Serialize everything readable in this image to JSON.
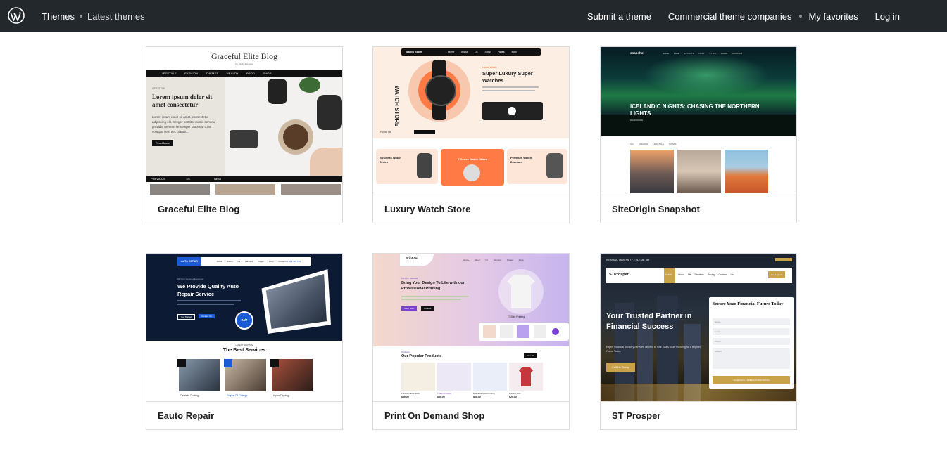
{
  "topbar": {
    "logo": "wordpress-logo",
    "breadcrumb": [
      "Themes",
      "Latest themes"
    ],
    "links": [
      "Submit a theme",
      "Commercial theme companies",
      "My favorites",
      "Log in"
    ]
  },
  "themes": [
    {
      "name": "Graceful Elite Blog",
      "preview": {
        "site_title": "Graceful Elite Blog",
        "tagline": "It's Totally Everyday",
        "menu": [
          "LIFESTYLE",
          "FASHION",
          "THEMES",
          "HEALTH",
          "FOOD",
          "SHOP"
        ],
        "kicker": "LIFESTYLE",
        "headline": "Lorem ipsum dolor sit amet consectetur",
        "body": "Lorem ipsum dolor sit amet, consectetur adipiscing elit. Integer porttitor mattis sem eu gravida. Aenean se semper placerat. Cras volutpat sem nec blandit...",
        "button": "Read More",
        "prev": "PREVIOUS",
        "page": "1/5",
        "next": "NEXT"
      }
    },
    {
      "name": "Luxury Watch Store",
      "preview": {
        "logo": "Watch Store",
        "menu": [
          "Home",
          "About Us",
          "Shop",
          "Pages",
          "Blog"
        ],
        "vertical": "WATCH STORE",
        "kicker": "Latest Watch",
        "headline": "Super Luxury Super Watches",
        "follow": "Follow Us",
        "sub1": "Business Watch Series",
        "promo": "Z Series Watch Offers",
        "sub2": "Premium Watch Discount"
      }
    },
    {
      "name": "SiteOrigin Snapshot",
      "preview": {
        "logo": "snapshot",
        "menu": [
          "HOME",
          "PAGE LAYOUTS",
          "POST",
          "STYLE GUIDE",
          "CONTACT"
        ],
        "headline": "ICELANDIC NIGHTS: CHASING THE NORTHERN LIGHTS",
        "read": "READ MORE",
        "filters": [
          "ALL",
          "FASHION",
          "LIFESTYLE",
          "TRAVEL"
        ]
      }
    },
    {
      "name": "Eauto Repair",
      "preview": {
        "logo": "AUTO REPAIR",
        "menu": [
          "Home",
          "About Us",
          "Services",
          "Pages",
          "Shop",
          "Contact"
        ],
        "phone": "+1 123 456 789",
        "kicker": "All Type Services Electronic",
        "headline": "We Provide Quality Auto Repair Service",
        "button1": "Get Started",
        "button2": "Contact Us",
        "badge": "24/7",
        "section_kicker": "LATEST SERVICE",
        "section_title": "The Best Services",
        "services": [
          "Ceramic Coating",
          "Engine Oil Change",
          "Hydro Dipping"
        ]
      }
    },
    {
      "name": "Print On Demand Shop",
      "preview": {
        "logo": "Print On",
        "menu": [
          "Home",
          "About Us",
          "Services",
          "Pages",
          "Shop"
        ],
        "kicker": "Print On Demand",
        "headline": "Bring Your Design To Life with our Professional Printing",
        "button1": "Shop Now",
        "button2": "Contact",
        "tshirt": "T-Shirt Printing",
        "section_kicker": "Products",
        "section_title": "Our Popular Products",
        "view_all": "View All",
        "products": [
          {
            "name": "Printed Name Here",
            "price": "$35.00"
          },
          {
            "name": "T-Shirt Printing",
            "price": "$35.00"
          },
          {
            "name": "Business Card Printing",
            "price": "$60.00"
          },
          {
            "name": "Printed Shirt",
            "price": "$20.00"
          }
        ]
      }
    },
    {
      "name": "ST Prosper",
      "preview": {
        "hours": "09:00 AM - 08:00 PM",
        "phone": "+ 1 012 456 789",
        "logo": "STProsper",
        "menu": [
          "Home",
          "About Us",
          "Services",
          "Pricing",
          "Contact Us"
        ],
        "quote_btn": "Get a Quote",
        "headline": "Your Trusted Partner in Financial Success",
        "sub": "Expert Financial Advisory Services Tailored to Your Goals. Start Planning for a Brighter Future Today.",
        "cta": "Call Us Today",
        "form_title": "Secure Your Financial Future Today",
        "fields": [
          "Name",
          "Email",
          "Phone",
          "Subject"
        ],
        "form_btn": "SCHEDULE A FREE CONSULTATION"
      }
    }
  ]
}
